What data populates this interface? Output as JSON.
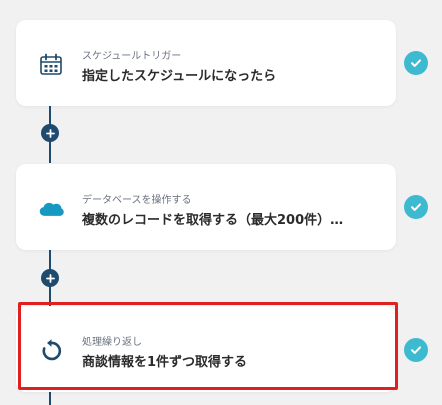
{
  "steps": [
    {
      "label": "スケジュールトリガー",
      "title": "指定したスケジュールになったら",
      "icon": "calendar-icon",
      "status": "complete"
    },
    {
      "label": "データベースを操作する",
      "title": "複数のレコードを取得する（最大200件）…",
      "icon": "salesforce-cloud-icon",
      "status": "complete"
    },
    {
      "label": "処理繰り返し",
      "title": "商談情報を1件ずつ取得する",
      "icon": "loop-icon",
      "status": "complete"
    }
  ],
  "colors": {
    "connector": "#1e4a6e",
    "check": "#3dbad0",
    "highlight": "#e02020",
    "salesforce": "#1798c1"
  }
}
